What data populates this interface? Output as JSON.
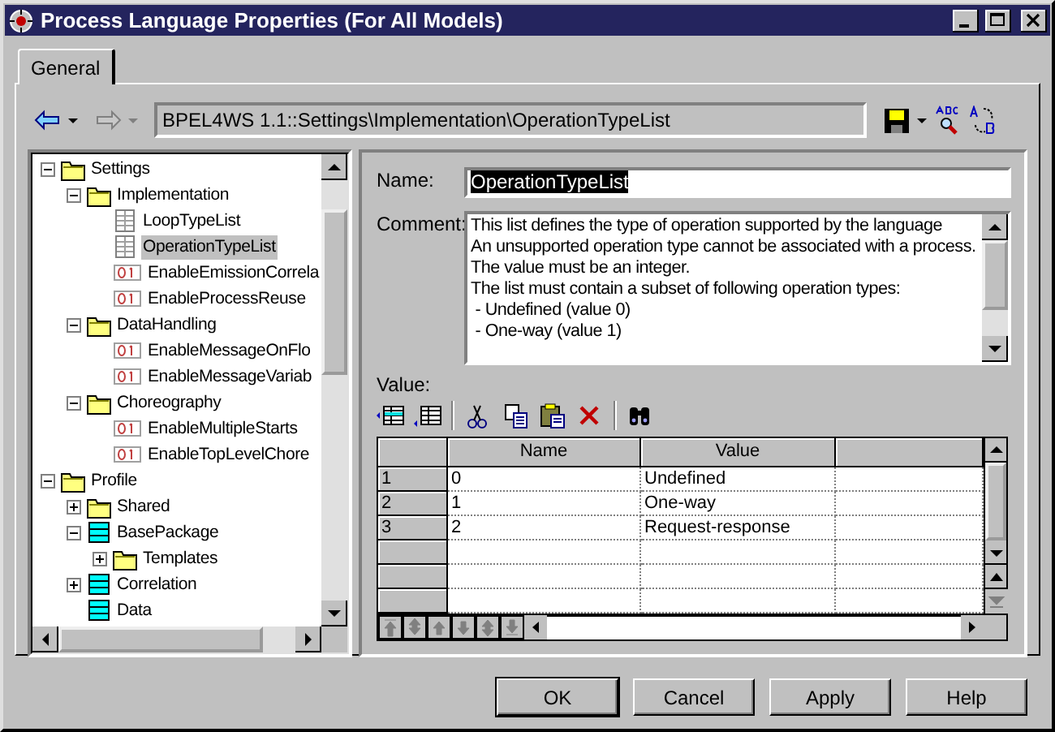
{
  "window": {
    "title": "Process Language Properties (For All Models)"
  },
  "tabs": [
    {
      "label": "General",
      "selected": true
    }
  ],
  "navigation": {
    "back_disabled": false,
    "forward_disabled": true,
    "path": "BPEL4WS 1.1::Settings\\Implementation\\OperationTypeList"
  },
  "tree": [
    {
      "label": "Settings",
      "kind": "folder",
      "expanded": true,
      "selected": false,
      "children": [
        {
          "label": "Implementation",
          "kind": "folder",
          "expanded": true,
          "selected": false,
          "children": [
            {
              "label": "LoopTypeList",
              "kind": "list",
              "selected": false
            },
            {
              "label": "OperationTypeList",
              "kind": "list",
              "selected": true
            },
            {
              "label": "EnableEmissionCorrela",
              "kind": "boolean",
              "selected": false
            },
            {
              "label": "EnableProcessReuse",
              "kind": "boolean",
              "selected": false
            }
          ]
        },
        {
          "label": "DataHandling",
          "kind": "folder",
          "expanded": true,
          "selected": false,
          "children": [
            {
              "label": "EnableMessageOnFlo",
              "kind": "boolean",
              "selected": false
            },
            {
              "label": "EnableMessageVariab",
              "kind": "boolean",
              "selected": false
            }
          ]
        },
        {
          "label": "Choreography",
          "kind": "folder",
          "expanded": true,
          "selected": false,
          "children": [
            {
              "label": "EnableMultipleStarts",
              "kind": "boolean",
              "selected": false
            },
            {
              "label": "EnableTopLevelChore",
              "kind": "boolean",
              "selected": false
            }
          ]
        }
      ]
    },
    {
      "label": "Profile",
      "kind": "folder",
      "expanded": true,
      "selected": false,
      "children": [
        {
          "label": "Shared",
          "kind": "folder",
          "expanded": false,
          "selected": false
        },
        {
          "label": "BasePackage",
          "kind": "package",
          "expanded": true,
          "selected": false,
          "children": [
            {
              "label": "Templates",
              "kind": "folder",
              "expanded": false,
              "selected": false
            }
          ]
        },
        {
          "label": "Correlation",
          "kind": "package",
          "expanded": false,
          "selected": false
        },
        {
          "label": "Data",
          "kind": "package",
          "selected": false
        }
      ]
    }
  ],
  "properties": {
    "name_label": "Name:",
    "name": "OperationTypeList",
    "name_text_selected": true,
    "comment_label": "Comment:",
    "comment": "This list defines the type of operation supported by the language\nAn unsupported operation type cannot be associated with a process.\nThe value must be an integer.\nThe list must contain a subset of following operation types:\n - Undefined (value 0)\n - One-way (value 1)",
    "value_label": "Value:"
  },
  "grid": {
    "columns": [
      "Name",
      "Value"
    ],
    "rows": [
      {
        "number": "1",
        "name": "0",
        "value": "Undefined"
      },
      {
        "number": "2",
        "name": "1",
        "value": "One-way"
      },
      {
        "number": "3",
        "name": "2",
        "value": "Request-response"
      }
    ]
  },
  "buttons": [
    {
      "label": "OK",
      "default": true
    },
    {
      "label": "Cancel",
      "default": false
    },
    {
      "label": "Apply",
      "default": false
    },
    {
      "label": "Help",
      "default": false
    }
  ]
}
